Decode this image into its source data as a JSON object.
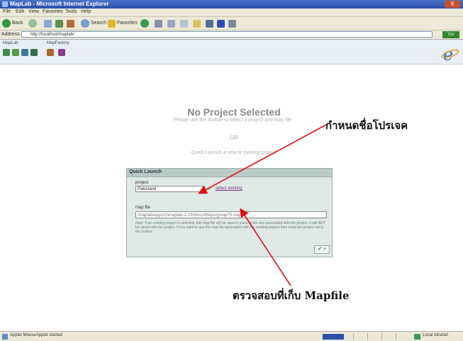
{
  "window": {
    "title": "MapLab - Microsoft Internet Explorer",
    "close_label": "X"
  },
  "menu": [
    "File",
    "Edit",
    "View",
    "Favorites",
    "Tools",
    "Help"
  ],
  "toolbar": {
    "back_label": "Back",
    "search_label": "Search",
    "favorites_label": "Favorites"
  },
  "address": {
    "label": "Address",
    "url": "http://localhost/maplab/",
    "go_label": "Go"
  },
  "app_groups": {
    "group1": "MapLab",
    "group2": "MapFactory"
  },
  "main": {
    "heading": "No Project Selected",
    "hint1": "Please use the toolbar to select a project and map file",
    "or_text": "OR",
    "hint2": "Quick Launch a new or existing project"
  },
  "quick_launch": {
    "title": "Quick Launch",
    "project_label": "project",
    "project_value": "Pakistand",
    "or_small": "or",
    "select_link": "select existing",
    "map_label": "map file",
    "map_placeholder": "/maplab/apps/chmaplab-2.2/htdocs/Maps/gmap75.map",
    "help_text": "Note: If an existing project is selected, this map file will be used in place of the one associated with the project. It will NOT be saved with the project. If you want to use the map file associated with the existing project then reset the project using the toolbar.",
    "ok_label": "✔ »"
  },
  "annotations": {
    "project_name": "กำหนดชื่อโปรเจค",
    "mapfile_location": "ตรวจสอบที่เก็บ Mapfile"
  },
  "statusbar": {
    "text": "Applet MouseApplet started",
    "zone": "Local intranet"
  },
  "colors": {
    "arrow": "#e01010",
    "panel_bg": "#dfe9e6",
    "titlebar": "#2a4fa8"
  }
}
